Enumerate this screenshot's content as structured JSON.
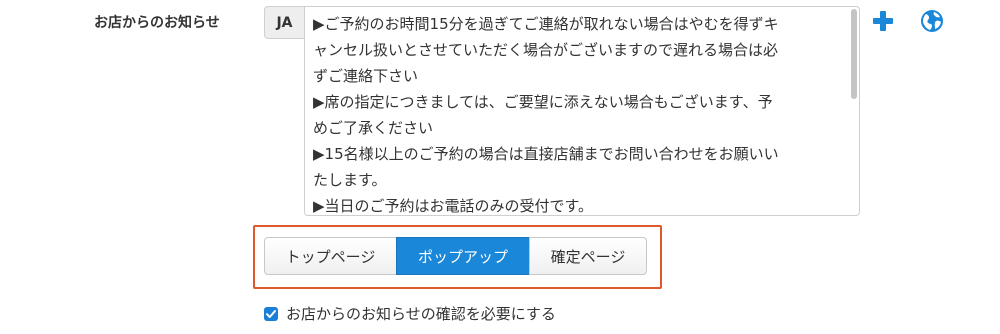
{
  "field": {
    "label": "お店からのお知らせ",
    "lang": "JA",
    "notice_lines": [
      "▶ご予約のお時間15分を過ぎてご連絡が取れない場合はやむを得ずキ",
      "ャンセル扱いとさせていただく場合がございますので遅れる場合は必",
      "ずご連絡下さい",
      "▶席の指定につきましては、ご要望に添えない場合もございます、予",
      "めご了承ください",
      "▶15名様以上のご予約の場合は直接店舗までお問い合わせをお願いい",
      "たします。",
      "▶当日のご予約はお電話のみの受付です。"
    ]
  },
  "icons": {
    "add": "plus-icon",
    "translate": "globe-icon",
    "accent": "#1a87d8"
  },
  "display_mode": {
    "options": [
      "トップページ",
      "ポップアップ",
      "確定ページ"
    ],
    "selected": "ポップアップ",
    "highlight_color": "#e0582e"
  },
  "confirm": {
    "checked": true,
    "label": "お店からのお知らせの確認を必要にする"
  }
}
